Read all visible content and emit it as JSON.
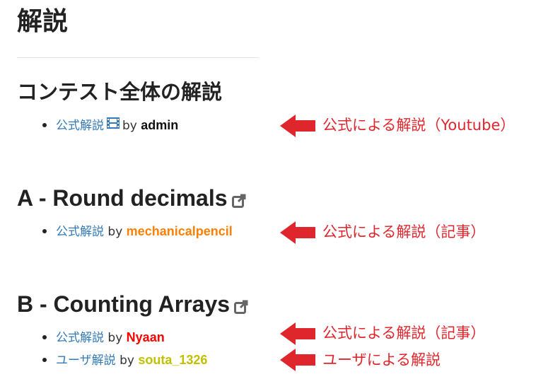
{
  "page": {
    "title": "解説"
  },
  "colors": {
    "link": "#337ab7",
    "annotation": "#e0262d",
    "user_admin": "#111111",
    "user_orange": "#ff8000",
    "user_red": "#ff0000",
    "user_yellow": "#c0c000"
  },
  "sections": [
    {
      "title": "コンテスト全体の解説",
      "has_external_icon": false,
      "items": [
        {
          "link": "公式解説",
          "icon": "film-icon",
          "by": "by",
          "user": "admin",
          "user_color": "#111111"
        }
      ]
    },
    {
      "title": "A - Round decimals",
      "has_external_icon": true,
      "items": [
        {
          "link": "公式解説",
          "by": "by",
          "user": "mechanicalpencil",
          "user_color": "#ff8000"
        }
      ]
    },
    {
      "title": "B - Counting Arrays",
      "has_external_icon": true,
      "items": [
        {
          "link": "公式解説",
          "by": "by",
          "user": "Nyaan",
          "user_color": "#ff0000"
        },
        {
          "link": "ユーザ解説",
          "by": "by",
          "user": "souta_1326",
          "user_color": "#c0c000"
        }
      ]
    }
  ],
  "annotations": [
    "公式による解説（Youtube）",
    "公式による解説（記事）",
    "公式による解説（記事）",
    "ユーザによる解説"
  ]
}
